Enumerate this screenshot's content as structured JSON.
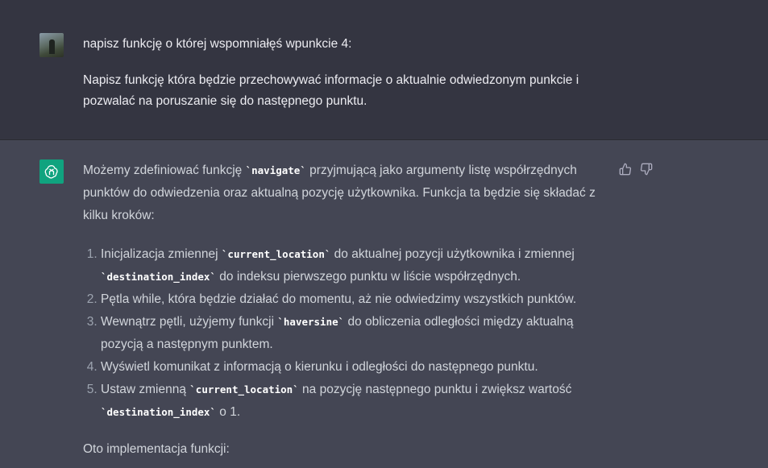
{
  "user": {
    "line1": "napisz funkcję o której wspomniałęś wpunkcie 4:",
    "line2": "Napisz funkcję która będzie przechowywać informacje o aktualnie odwiedzonym punkcie i pozwalać na poruszanie się do następnego punktu."
  },
  "assistant": {
    "intro_a": "Możemy zdefiniować funkcję ",
    "intro_code": "`navigate`",
    "intro_b": " przyjmującą jako argumenty listę współrzędnych punktów do odwiedzenia oraz aktualną pozycję użytkownika. Funkcja ta będzie się składać z kilku kroków:",
    "steps": [
      {
        "a": "Inicjalizacja zmiennej ",
        "c1": "`current_location`",
        "b": " do aktualnej pozycji użytkownika i zmiennej ",
        "c2": "`destination_index`",
        "d": " do indeksu pierwszego punktu w liście współrzędnych."
      },
      {
        "a": "Pętla while, która będzie działać do momentu, aż nie odwiedzimy wszystkich punktów."
      },
      {
        "a": "Wewnątrz pętli, użyjemy funkcji ",
        "c1": "`haversine`",
        "b": " do obliczenia odległości między aktualną pozycją a następnym punktem."
      },
      {
        "a": "Wyświetl komunikat z informacją o kierunku i odległości do następnego punktu."
      },
      {
        "a": "Ustaw zmienną ",
        "c1": "`current_location`",
        "b": " na pozycję następnego punktu i zwiększ wartość ",
        "c2": "`destination_index`",
        "d": " o 1."
      }
    ],
    "outro": "Oto implementacja funkcji:"
  },
  "icons": {
    "like": "thumbs-up-icon",
    "dislike": "thumbs-down-icon",
    "assistant_logo": "openai-logo-icon"
  },
  "colors": {
    "assistant_logo_bg": "#10a37f",
    "user_bg": "#343541",
    "assistant_bg": "#444654"
  }
}
